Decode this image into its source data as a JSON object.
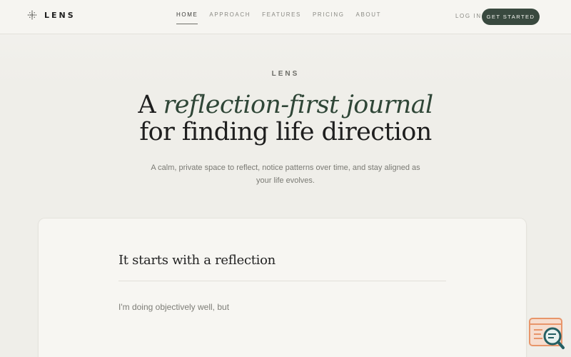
{
  "brand": {
    "name": "LENS",
    "icon": "sparkle-grid-icon"
  },
  "nav": {
    "items": [
      {
        "label": "HOME",
        "active": true
      },
      {
        "label": "APPROACH",
        "active": false
      },
      {
        "label": "FEATURES",
        "active": false
      },
      {
        "label": "PRICING",
        "active": false
      },
      {
        "label": "ABOUT",
        "active": false
      }
    ],
    "login_label": "LOG IN",
    "cta_label": "GET STARTED"
  },
  "hero": {
    "eyebrow": "LENS",
    "headline_prefix": "A ",
    "headline_accent": "reflection-first journal",
    "headline_line2": "for finding life direction",
    "subtitle": "A calm, private space to reflect, notice patterns over time, and stay aligned as your life evolves."
  },
  "card": {
    "title": "It starts with a reflection",
    "text": "I'm doing objectively well, but"
  },
  "colors": {
    "background": "#efeee9",
    "header_background": "#f6f5f1",
    "accent_green": "#2f4637",
    "cta_background": "#39493f",
    "muted_text": "#7a7a74",
    "widget_orange": "#e8956a",
    "widget_teal": "#245f63"
  },
  "widget": {
    "icon": "chat-search-icon"
  }
}
